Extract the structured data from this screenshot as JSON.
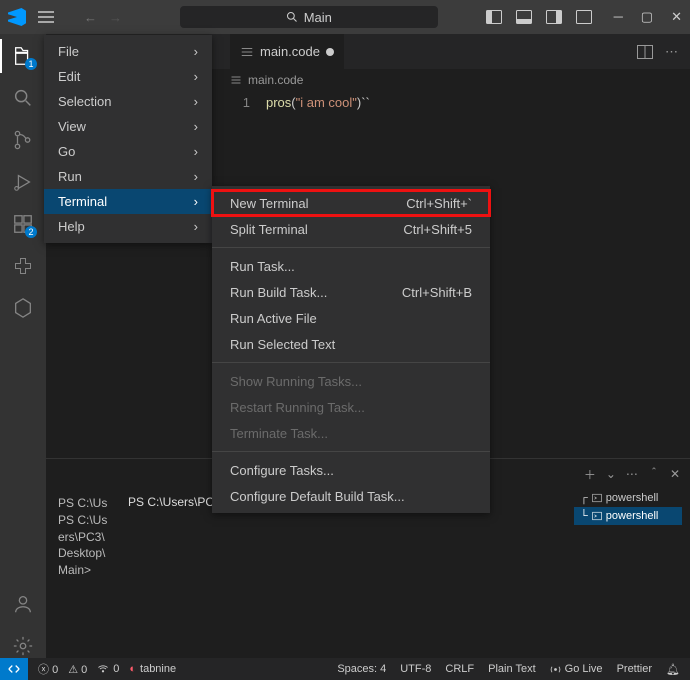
{
  "title": "Main",
  "main_menu": {
    "items": [
      {
        "label": "File",
        "sub": true
      },
      {
        "label": "Edit",
        "sub": true
      },
      {
        "label": "Selection",
        "sub": true
      },
      {
        "label": "View",
        "sub": true
      },
      {
        "label": "Go",
        "sub": true
      },
      {
        "label": "Run",
        "sub": true
      },
      {
        "label": "Terminal",
        "sub": true,
        "highlight": true
      },
      {
        "label": "Help",
        "sub": true
      }
    ]
  },
  "submenu": {
    "items": [
      {
        "label": "New Terminal",
        "shortcut": "Ctrl+Shift+`",
        "first": true
      },
      {
        "label": "Split Terminal",
        "shortcut": "Ctrl+Shift+5"
      },
      {
        "sep": true
      },
      {
        "label": "Run Task..."
      },
      {
        "label": "Run Build Task...",
        "shortcut": "Ctrl+Shift+B"
      },
      {
        "label": "Run Active File"
      },
      {
        "label": "Run Selected Text"
      },
      {
        "sep": true
      },
      {
        "label": "Show Running Tasks...",
        "disabled": true
      },
      {
        "label": "Restart Running Task...",
        "disabled": true
      },
      {
        "label": "Terminate Task...",
        "disabled": true
      },
      {
        "sep": true
      },
      {
        "label": "Configure Tasks..."
      },
      {
        "label": "Configure Default Build Task..."
      }
    ]
  },
  "tabs": {
    "file": "main.code"
  },
  "breadcrumb": {
    "file": "main.code"
  },
  "code": {
    "line1_no": "1",
    "fn": "pros",
    "paren_open": "(",
    "str": "\"i am cool\"",
    "paren_close": ")``"
  },
  "activity": {
    "explorer_badge": "1",
    "ext_badge": "2"
  },
  "terminal": {
    "extra": "Ma",
    "left": "PS C:\\Us\nPS C:\\Us\ners\\PC3\\\nDesktop\\\nMain>",
    "right": "PS C:\\Users\\PC3\\Desktop\\Main>",
    "shells": [
      "powershell",
      "powershell"
    ]
  },
  "status": {
    "errors": "0",
    "warnings": "0",
    "ports": "0",
    "tabnine": "tabnine",
    "spaces": "Spaces: 4",
    "enc": "UTF-8",
    "eol": "CRLF",
    "lang": "Plain Text",
    "golive": "Go Live",
    "prettier": "Prettier"
  }
}
